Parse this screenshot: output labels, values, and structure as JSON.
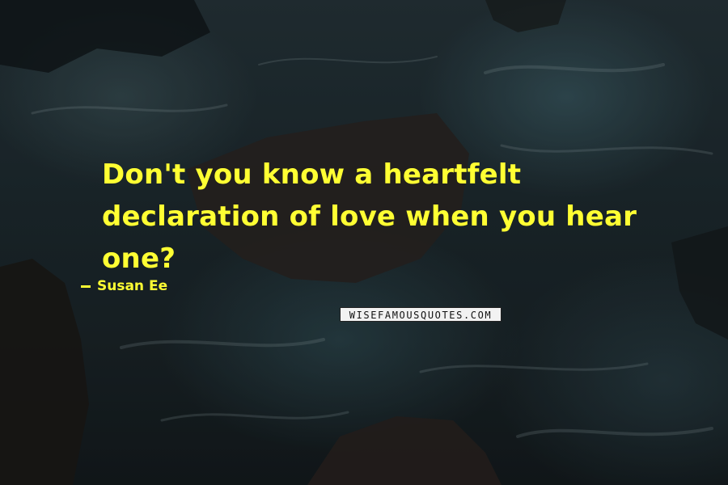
{
  "quote": {
    "text": "Don't you know a heartfelt declaration of love when you hear one?",
    "color": "#ffff33"
  },
  "author": {
    "name": "Susan Ee"
  },
  "watermark": {
    "text": "WISEFAMOUSQUOTES.COM"
  }
}
